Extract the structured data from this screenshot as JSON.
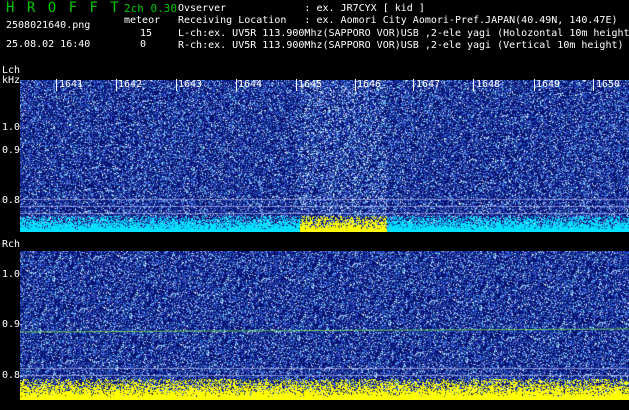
{
  "header": {
    "title": "H R O F F T",
    "version": "2ch 0.30",
    "filename": "2508021640.png",
    "meteor_label": "meteor",
    "meteor_count_l": "15",
    "datetime": "25.08.02 16:40",
    "meteor_count_r": "0",
    "info_lines": [
      "Ovserver             : ex. JR7CYX [ kid ]",
      "Receiving Location   : ex. Aomori City Aomori-Pref.JAPAN(40.49N, 140.47E)",
      "L-ch:ex. UV5R 113.900Mhz(SAPPORO VOR)USB ,2-ele yagi (Holozontal 10m height",
      "R-ch:ex. UV5R 113.900Mhz(SAPPORO VOR)USB ,2-ele yagi (Vertical 10m height)"
    ]
  },
  "left_channel": {
    "label": "Lch",
    "unit": "kHz",
    "y_ticks": [
      "1.0",
      "0.9",
      "0.8"
    ],
    "time_ticks": [
      "1641",
      "1642",
      "1643",
      "1644",
      "1645",
      "1646",
      "1647",
      "1648",
      "1649",
      "1650"
    ],
    "meteor_count": 15
  },
  "right_channel": {
    "label": "Rch",
    "y_ticks": [
      "1.0",
      "0.9",
      "0.8"
    ],
    "meteor_count": 0
  },
  "colors": {
    "title": "#00c800",
    "version": "#00c800",
    "text": "#ffffff",
    "background": "#000000",
    "noise_bar": "#ffff00",
    "baseline": "#00e0ff",
    "waterfall_base": "#0a1e8c"
  }
}
